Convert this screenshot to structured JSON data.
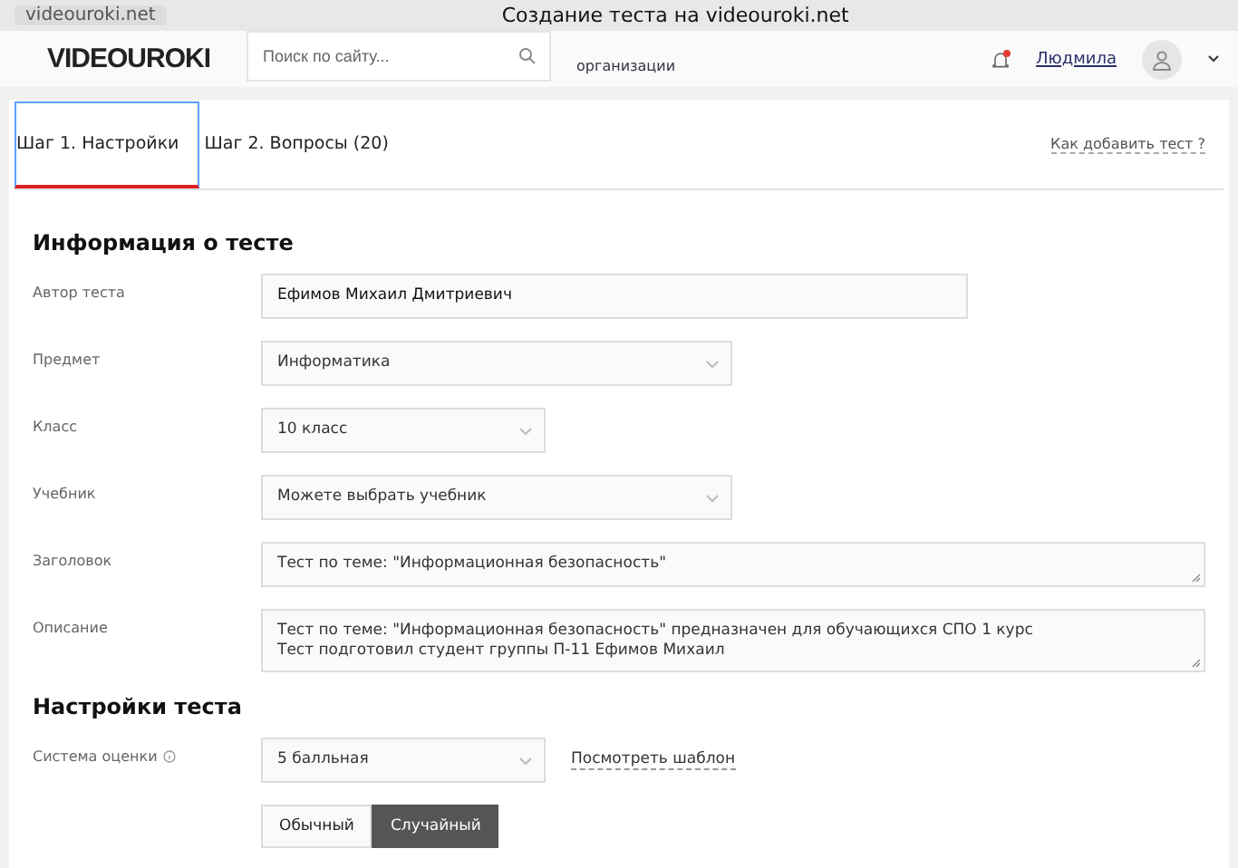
{
  "browser": {
    "address": "videouroki.net",
    "title": "Создание теста на videouroki.net"
  },
  "header": {
    "logo": "VIDEOUROKI",
    "search": {
      "placeholder": "Поиск по сайту..."
    },
    "promo": "организации",
    "notification_badge": true,
    "user": "Людмила"
  },
  "tabs": [
    {
      "label": "Шаг 1. Настройки",
      "selected": true
    },
    {
      "label": "Шаг 2. Вопросы (20)",
      "selected": false
    }
  ],
  "help_link": "Как добавить тест ?",
  "sections": [
    {
      "title": "Информация о тесте",
      "fields": [
        {
          "kind": "input",
          "label": "Автор теста",
          "value": "Ефимов Михаил Дмитриевич"
        },
        {
          "kind": "select",
          "label": "Предмет",
          "value": "Информатика"
        },
        {
          "kind": "select",
          "label": "Класс",
          "value": "10 класс"
        },
        {
          "kind": "select",
          "label": "Учебник",
          "value": "Можете выбрать учебник"
        },
        {
          "kind": "textarea",
          "label": "Заголовок",
          "value": "Тест по теме: \"Информационная безопасность\""
        },
        {
          "kind": "textarea",
          "label": "Описание",
          "value": "Тест по теме: \"Информационная безопасность\" предназначен для обучающихся СПО 1 курс\nТест подготовил студент группы П-11 Ефимов Михаил"
        }
      ]
    },
    {
      "title": "Настройки теста",
      "fields": [
        {
          "kind": "select",
          "label": "Система оценки",
          "info": true,
          "value": "5 балльная",
          "link": "Посмотреть шаблон"
        },
        {
          "kind": "toggle",
          "options": [
            {
              "label": "Обычный",
              "selected": false
            },
            {
              "label": "Случайный",
              "selected": true
            }
          ]
        }
      ]
    }
  ]
}
